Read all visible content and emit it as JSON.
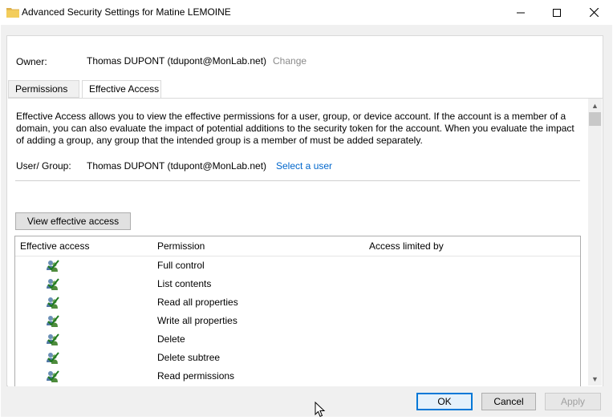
{
  "window": {
    "title": "Advanced Security Settings for Matine LEMOINE",
    "controls": [
      "minimize",
      "maximize",
      "close"
    ]
  },
  "owner": {
    "label": "Owner:",
    "value": "Thomas DUPONT (tdupont@MonLab.net)",
    "change_label": "Change"
  },
  "tabs": [
    {
      "label": "Permissions",
      "active": false
    },
    {
      "label": "Effective Access",
      "active": true
    }
  ],
  "effective_access": {
    "description": "Effective Access allows you to view the effective permissions for a user, group, or device account. If the account is a member of a domain, you can also evaluate the impact of potential additions to the security token for the account. When you evaluate the impact of adding a group, any group that the intended group is a member of must be added separately.",
    "user_group_label": "User/ Group:",
    "user_group_value": "Thomas DUPONT (tdupont@MonLab.net)",
    "select_user_label": "Select a user",
    "view_button_label": "View effective access",
    "columns": [
      "Effective access",
      "Permission",
      "Access limited by"
    ],
    "rows": [
      {
        "permission": "Full control",
        "icon": "allowed-icon"
      },
      {
        "permission": "List contents",
        "icon": "allowed-icon"
      },
      {
        "permission": "Read all properties",
        "icon": "allowed-icon"
      },
      {
        "permission": "Write all properties",
        "icon": "allowed-icon"
      },
      {
        "permission": "Delete",
        "icon": "allowed-icon"
      },
      {
        "permission": "Delete subtree",
        "icon": "allowed-icon"
      },
      {
        "permission": "Read permissions",
        "icon": "allowed-icon"
      }
    ]
  },
  "footer": {
    "ok_label": "OK",
    "cancel_label": "Cancel",
    "apply_label": "Apply"
  },
  "colors": {
    "accent": "#0078d7",
    "link": "#0066cc",
    "disabled_link": "#8a8a8a"
  }
}
